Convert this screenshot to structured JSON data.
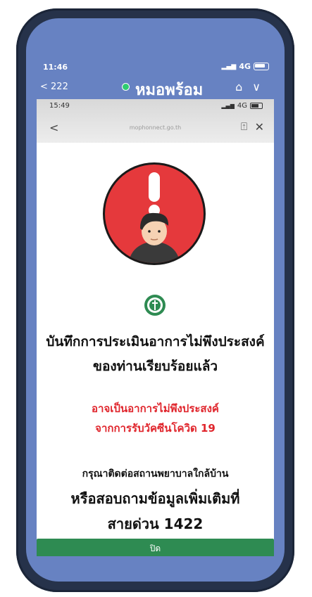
{
  "outer_status": {
    "time": "11:46",
    "network": "4G"
  },
  "outer_nav": {
    "back_label": "< 222",
    "title": "หมอพร้อม",
    "icons": [
      "home-icon",
      "chevron-down-icon"
    ]
  },
  "inner_status": {
    "time": "15:49",
    "network": "4G"
  },
  "inner_nav": {
    "back": "<",
    "url": "mophonnect.go.th",
    "share": "share-icon",
    "close": "close-icon"
  },
  "alert_icon": "warning-person-icon",
  "logo_icon": "moph-logo-icon",
  "message": {
    "line1": "บันทึกการประเมินอาการไม่พึงประสงค์",
    "line2": "ของท่านเรียบร้อยแล้ว"
  },
  "warning": {
    "line1": "อาจเป็นอาการไม่พึงประสงค์",
    "line2": "จากการรับวัคซีนโควิด 19"
  },
  "contact": {
    "line1": "กรุณาติดต่อสถานพยาบาลใกล้บ้าน",
    "line2": "หรือสอบถามข้อมูลเพิ่มเติมที่",
    "hotline": "สายด่วน 1422"
  },
  "close_button": {
    "label": "ปิด"
  },
  "colors": {
    "accent_green": "#2e8b52",
    "warning_red": "#e0252c",
    "phone_blue": "#6782c2"
  }
}
